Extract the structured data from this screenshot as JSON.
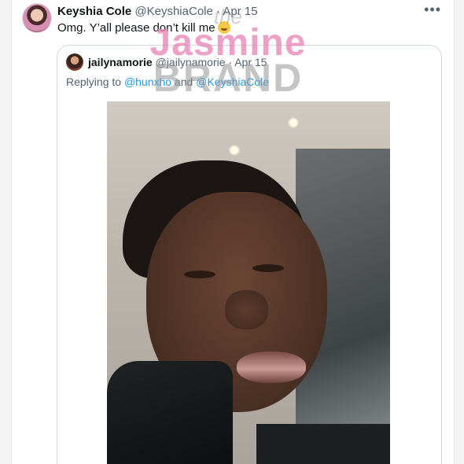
{
  "tweet": {
    "author_name": "Keyshia Cole",
    "handle": "@KeyshiaCole",
    "separator": "·",
    "date": "Apr 15",
    "text": "Omg.  Y’all please don’t kill me",
    "more_icon": "more-icon"
  },
  "quoted": {
    "author_name": "jailynamorie",
    "handle": "@jailynamorie",
    "separator": "·",
    "date": "Apr 15",
    "reply_prefix": "Replying to",
    "reply_user1": "@hunxho",
    "reply_and": "and",
    "reply_user2": "@KeyshiaCole"
  },
  "watermark": {
    "line1": "the",
    "line2": "Jasmine",
    "line3": "BRAND"
  },
  "colors": {
    "link": "#1d9bf0",
    "muted": "#536471",
    "border": "#cfd9de"
  }
}
